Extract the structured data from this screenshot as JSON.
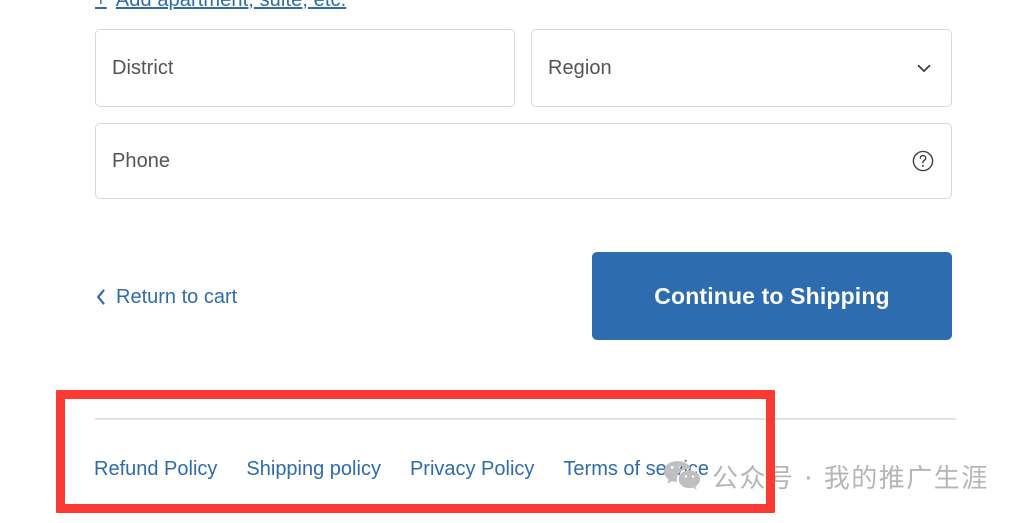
{
  "form": {
    "add_apartment_link": {
      "plus": "+",
      "label": "Add apartment, suite, etc."
    },
    "fields": [
      {
        "name": "district",
        "placeholder": "District",
        "value": "",
        "type": "text"
      },
      {
        "name": "region",
        "placeholder": "Region",
        "value": "",
        "type": "select",
        "icon": "chevron-down-icon"
      },
      {
        "name": "phone",
        "placeholder": "Phone",
        "value": "",
        "type": "tel",
        "icon": "help-circle-icon"
      }
    ]
  },
  "actions": {
    "return_to_cart": "Return to cart",
    "return_to_cart_icon": "chevron-left-icon",
    "continue_button": "Continue to Shipping"
  },
  "footer": {
    "links": [
      "Refund Policy",
      "Shipping policy",
      "Privacy Policy",
      "Terms of service"
    ]
  },
  "watermark": {
    "icon": "wechat-icon",
    "text": "公众号 · 我的推广生涯"
  },
  "colors": {
    "accent_blue": "#2f6cad",
    "button_blue": "#2d6cae",
    "annotation_red": "#fb3a33",
    "placeholder_gray": "#545454",
    "border_gray": "#d9d9d9",
    "divider_gray": "#e2e2e2",
    "watermark_gray": "#b6b6b6"
  }
}
